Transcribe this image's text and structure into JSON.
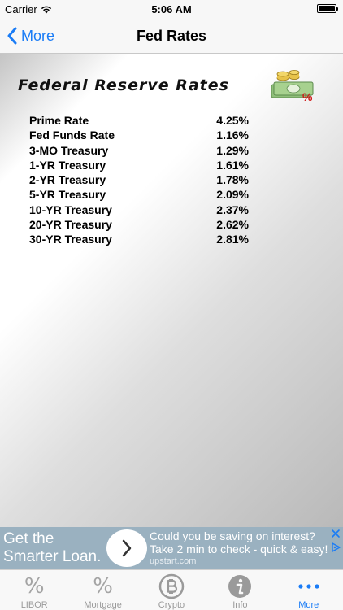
{
  "status_bar": {
    "carrier": "Carrier",
    "time": "5:06 AM"
  },
  "nav": {
    "back_label": "More",
    "title": "Fed Rates"
  },
  "content": {
    "heading": "Federal Reserve Rates",
    "rates": [
      {
        "name": "Prime Rate",
        "value": "4.25%"
      },
      {
        "name": "Fed Funds Rate",
        "value": "1.16%"
      },
      {
        "name": "3-MO Treasury",
        "value": "1.29%"
      },
      {
        "name": "1-YR Treasury",
        "value": "1.61%"
      },
      {
        "name": "2-YR Treasury",
        "value": "1.78%"
      },
      {
        "name": "5-YR Treasury",
        "value": "2.09%"
      },
      {
        "name": "10-YR Treasury",
        "value": "2.37%"
      },
      {
        "name": "20-YR Treasury",
        "value": "2.62%"
      },
      {
        "name": "30-YR Treasury",
        "value": "2.81%"
      }
    ],
    "icon_label": "%"
  },
  "ad": {
    "left_line1": "Get the",
    "left_line2": "Smarter Loan.",
    "right_line1": "Could you be saving on interest?",
    "right_line2": "Take 2 min to check - quick & easy!",
    "url": "upstart.com",
    "background_color": "#9ab1c0"
  },
  "tabs": [
    {
      "label": "LIBOR",
      "icon": "percent-icon",
      "glyph": "%"
    },
    {
      "label": "Mortgage",
      "icon": "percent-icon",
      "glyph": "%"
    },
    {
      "label": "Crypto",
      "icon": "bitcoin-icon"
    },
    {
      "label": "Info",
      "icon": "info-icon"
    },
    {
      "label": "More",
      "icon": "more-icon",
      "active": true
    }
  ],
  "colors": {
    "accent": "#1a7cf6",
    "tab_inactive": "#9a9a9a"
  }
}
